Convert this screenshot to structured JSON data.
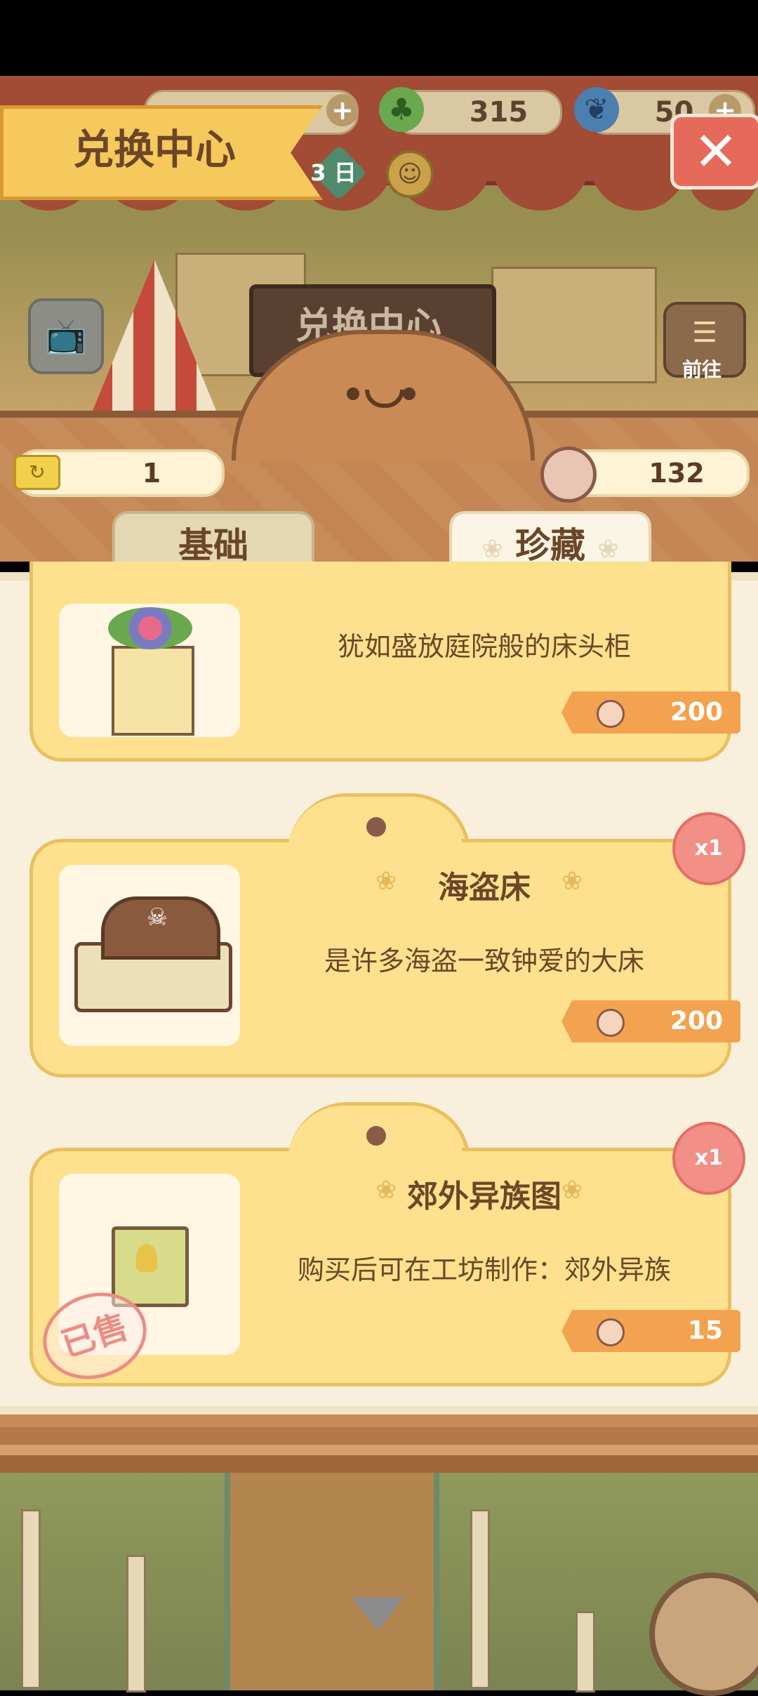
{
  "header": {
    "title": "兑换中心",
    "clover_count": "315",
    "feather_count": "50",
    "day_label": "3 日",
    "signboard_text": "兑换中心",
    "go_label": "前往"
  },
  "balances": {
    "ticket_count": "1",
    "coin_count": "132"
  },
  "tabs": [
    {
      "label": "基础"
    },
    {
      "label": "珍藏"
    }
  ],
  "items": [
    {
      "name": "",
      "description": "犹如盛放庭院般的床头柜",
      "price": "200",
      "qty": "",
      "sold": false
    },
    {
      "name": "海盗床",
      "description": "是许多海盗一致钟爱的大床",
      "price": "200",
      "qty": "x1",
      "sold": false
    },
    {
      "name": "郊外异族图",
      "description": "购买后可在工坊制作：郊外异族",
      "price": "15",
      "qty": "x1",
      "sold": true,
      "sold_label": "已售"
    }
  ],
  "colors": {
    "accent": "#f6c95d",
    "card": "#fde18e",
    "price_tag": "#f3a24f",
    "badge": "#f28f87"
  }
}
